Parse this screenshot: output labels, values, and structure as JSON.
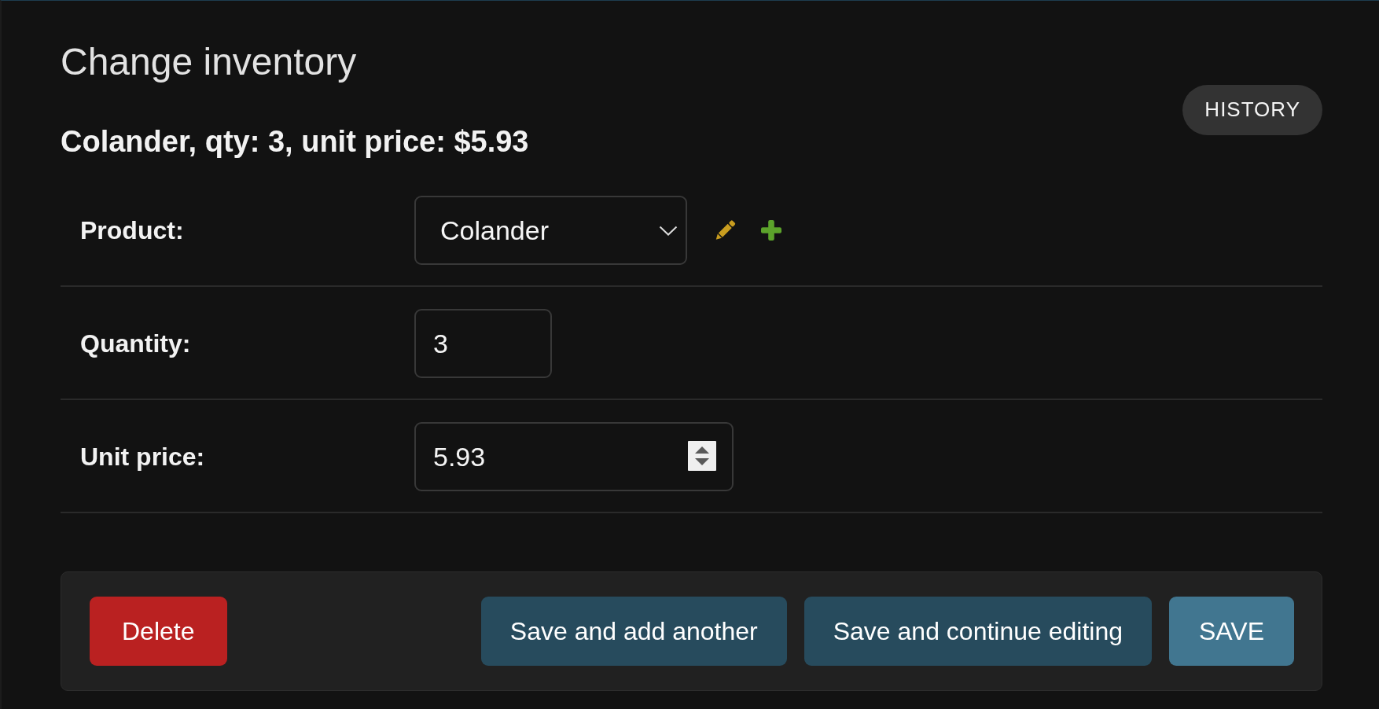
{
  "page": {
    "title": "Change inventory",
    "object_title": "Colander, qty: 3, unit price: $5.93",
    "history_button": {
      "label": "HISTORY"
    }
  },
  "fields": [
    {
      "kind": "related_select",
      "label": "Product:",
      "value": "Colander"
    },
    {
      "kind": "text",
      "label": "Quantity:",
      "value": "3"
    },
    {
      "kind": "number",
      "label": "Unit price:",
      "value": "5.93"
    }
  ],
  "submit_row": {
    "buttons": [
      {
        "kind": "delete",
        "label": "Delete"
      },
      {
        "kind": "secondary",
        "label": "Save and add another"
      },
      {
        "kind": "secondary",
        "label": "Save and continue editing"
      },
      {
        "kind": "primary",
        "label": "SAVE"
      }
    ]
  }
}
